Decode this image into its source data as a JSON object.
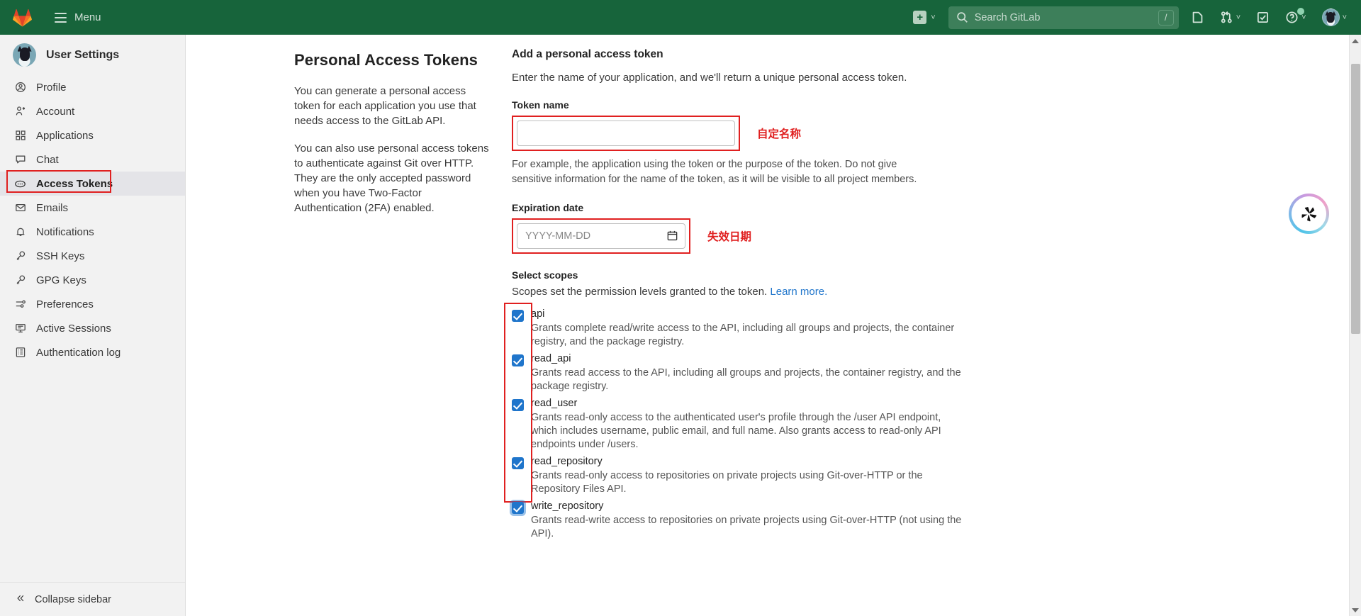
{
  "navbar": {
    "logo_icon": "gitlab-fox-logo",
    "menu_label": "Menu",
    "create_new_icon": "plus-icon",
    "create_new_chevron": "chevron-down-icon",
    "search": {
      "placeholder": "Search GitLab",
      "icon": "search-icon",
      "shortcut_key": "/"
    },
    "icons": [
      {
        "name": "issues-icon",
        "glyph": "issues"
      },
      {
        "name": "merge-requests-icon",
        "glyph": "merge"
      },
      {
        "name": "todos-icon",
        "glyph": "todo"
      },
      {
        "name": "help-icon",
        "glyph": "help"
      }
    ],
    "avatar_alt": "user-avatar",
    "brand_color": "#17643b"
  },
  "sidebar": {
    "title": "User Settings",
    "avatar_alt": "user-avatar",
    "items": [
      {
        "label": "Profile",
        "icon": "user-circle-icon",
        "active": false
      },
      {
        "label": "Account",
        "icon": "account-icon",
        "active": false
      },
      {
        "label": "Applications",
        "icon": "applications-grid-icon",
        "active": false
      },
      {
        "label": "Chat",
        "icon": "chat-bubble-icon",
        "active": false
      },
      {
        "label": "Access Tokens",
        "icon": "token-icon",
        "active": true
      },
      {
        "label": "Emails",
        "icon": "envelope-icon",
        "active": false
      },
      {
        "label": "Notifications",
        "icon": "bell-icon",
        "active": false
      },
      {
        "label": "SSH Keys",
        "icon": "key-icon",
        "active": false
      },
      {
        "label": "GPG Keys",
        "icon": "key-icon",
        "active": false
      },
      {
        "label": "Preferences",
        "icon": "sliders-icon",
        "active": false
      },
      {
        "label": "Active Sessions",
        "icon": "monitor-icon",
        "active": false
      },
      {
        "label": "Authentication log",
        "icon": "log-list-icon",
        "active": false
      }
    ],
    "collapse_label": "Collapse sidebar",
    "collapse_icon": "chevron-double-left-icon"
  },
  "main": {
    "page_title": "Personal Access Tokens",
    "intro_paragraph_1": "You can generate a personal access token for each application you use that needs access to the GitLab API.",
    "intro_paragraph_2": "You can also use personal access tokens to authenticate against Git over HTTP. They are the only accepted password when you have Two-Factor Authentication (2FA) enabled.",
    "form": {
      "heading": "Add a personal access token",
      "subheading": "Enter the name of your application, and we'll return a unique personal access token.",
      "token_name_label": "Token name",
      "token_name_value": "",
      "token_name_placeholder": "",
      "token_name_help": "For example, the application using the token or the purpose of the token. Do not give sensitive information for the name of the token, as it will be visible to all project members.",
      "expiration_label": "Expiration date",
      "expiration_value": "",
      "expiration_placeholder": "YYYY-MM-DD",
      "calendar_icon": "calendar-icon"
    },
    "scopes": {
      "heading": "Select scopes",
      "description": "Scopes set the permission levels granted to the token.",
      "learn_more": "Learn more.",
      "items": [
        {
          "name": "api",
          "checked": true,
          "focused": false,
          "description": "Grants complete read/write access to the API, including all groups and projects, the container registry, and the package registry."
        },
        {
          "name": "read_api",
          "checked": true,
          "focused": false,
          "description": "Grants read access to the API, including all groups and projects, the container registry, and the package registry."
        },
        {
          "name": "read_user",
          "checked": true,
          "focused": false,
          "description": "Grants read-only access to the authenticated user's profile through the /user API endpoint, which includes username, public email, and full name. Also grants access to read-only API endpoints under /users."
        },
        {
          "name": "read_repository",
          "checked": true,
          "focused": false,
          "description": "Grants read-only access to repositories on private projects using Git-over-HTTP or the Repository Files API."
        },
        {
          "name": "write_repository",
          "checked": true,
          "focused": true,
          "description": "Grants read-write access to repositories on private projects using Git-over-HTTP (not using the API)."
        }
      ]
    }
  },
  "annotations": {
    "color": "#e02020",
    "token_name_note": "自定名称",
    "expiration_note": "失效日期"
  },
  "float_widget": {
    "icon": "tri-blade-logo-icon"
  },
  "scrollbar": {
    "up_arrow_icon": "scroll-up-arrow-icon",
    "down_arrow_icon": "scroll-down-arrow-icon"
  }
}
